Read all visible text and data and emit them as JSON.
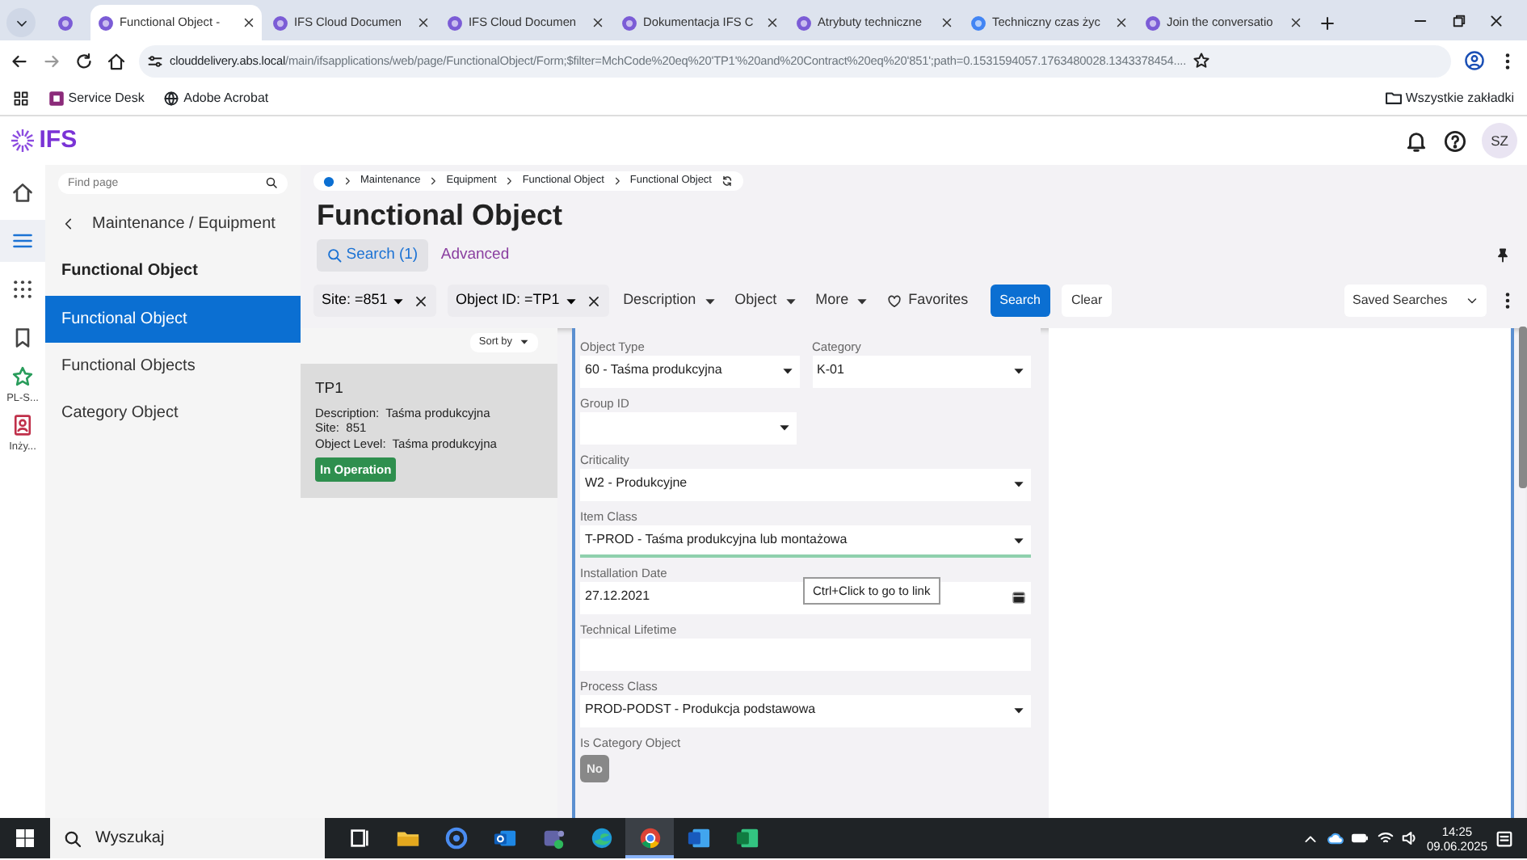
{
  "browser": {
    "tabs": [
      {
        "selected": false
      },
      {
        "title": "Functional Object -",
        "selected": true
      },
      {
        "title": "IFS Cloud Documen",
        "selected": false
      },
      {
        "title": "IFS Cloud Documen",
        "selected": false
      },
      {
        "title": "Dokumentacja IFS C",
        "selected": false
      },
      {
        "title": "Atrybuty techniczne",
        "selected": false
      },
      {
        "title": "Techniczny czas życ",
        "selected": false
      },
      {
        "title": "Join the conversatio",
        "selected": false
      }
    ],
    "url_host": "clouddelivery.abs.local",
    "url_path": "/main/ifsapplications/web/page/FunctionalObject/Form;$filter=MchCode%20eq%20'TP1'%20and%20Contract%20eq%20'851';path=0.1531594057.1763480028.1343378454....",
    "bookmarks": [
      "Service Desk",
      "Adobe Acrobat"
    ],
    "all_bookmarks": "Wszystkie zakładki"
  },
  "app": {
    "logo": "IFS",
    "avatar": "SZ",
    "rail": [
      {
        "kind": "home",
        "selected": false
      },
      {
        "kind": "menu",
        "selected": true
      },
      {
        "kind": "apps",
        "selected": false
      },
      {
        "kind": "bookmark",
        "selected": false
      },
      {
        "kind": "star",
        "label": "PL-S...",
        "selected": false
      },
      {
        "kind": "contact",
        "label": "Inży...",
        "selected": false
      }
    ]
  },
  "nav": {
    "placeholder": "Find page",
    "back_label": "Maintenance / Equipment",
    "heading": "Functional Object",
    "items": [
      {
        "label": "Functional Object",
        "selected": true
      },
      {
        "label": "Functional Objects",
        "selected": false
      },
      {
        "label": "Category Object",
        "selected": false
      }
    ]
  },
  "page": {
    "breadcrumb": [
      "Maintenance",
      "Equipment",
      "Functional Object",
      "Functional Object"
    ],
    "title": "Functional Object",
    "search_tabs": [
      {
        "label": "Search (1)",
        "selected": true
      },
      {
        "label": "Advanced",
        "selected": false
      }
    ],
    "filters": [
      {
        "kind": "chip",
        "label": "Site: =851"
      },
      {
        "kind": "chip",
        "label": "Object ID: =TP1"
      },
      {
        "kind": "menu",
        "label": "Description"
      },
      {
        "kind": "menu",
        "label": "Object"
      },
      {
        "kind": "menu",
        "label": "More"
      }
    ],
    "favorites": "Favorites",
    "search_button": "Search",
    "clear_button": "Clear",
    "saved_searches": "Saved Searches"
  },
  "list": {
    "sort_label": "Sort by",
    "records": [
      {
        "id": "TP1",
        "selected": true,
        "fields": [
          {
            "label": "Description:",
            "value": "Taśma produkcyjna"
          },
          {
            "label": "Site:",
            "value": "851"
          },
          {
            "label": "Object Level:",
            "value": "Taśma produkcyjna"
          }
        ],
        "status": "In Operation"
      }
    ]
  },
  "form": {
    "rows": [
      [
        {
          "label": "Object Type",
          "kind": "select",
          "value": "60 - Taśma produkcyjna",
          "focused": false
        },
        {
          "label": "Category",
          "kind": "select",
          "value": "K-01",
          "focused": false
        }
      ],
      [
        {
          "label": "Group ID",
          "kind": "select",
          "focused": false
        }
      ],
      [
        {
          "label": "Criticality",
          "kind": "select",
          "value": "W2 - Produkcyjne",
          "focused": false
        }
      ],
      [
        {
          "label": "Item Class",
          "kind": "select",
          "value": "T-PROD - Taśma produkcyjna lub montażowa",
          "focused": true
        }
      ],
      [
        {
          "label": "Installation Date",
          "kind": "date",
          "value": "27.12.2021",
          "focused": false
        }
      ],
      [
        {
          "label": "Technical Lifetime",
          "kind": "text",
          "focused": false
        }
      ],
      [
        {
          "label": "Process Class",
          "kind": "select",
          "value": "PROD-PODST - Produkcja podstawowa",
          "focused": false
        }
      ],
      [
        {
          "label": "Is Category Object",
          "kind": "toggle",
          "value": "No"
        }
      ]
    ],
    "tooltip": "Ctrl+Click to go to link"
  },
  "taskbar": {
    "search": "Wyszukaj",
    "apps": [
      {
        "kind": "taskview",
        "selected": false
      },
      {
        "kind": "folder",
        "selected": false
      },
      {
        "kind": "swirl",
        "selected": false
      },
      {
        "kind": "mail",
        "selected": false
      },
      {
        "kind": "teams",
        "selected": false
      },
      {
        "kind": "edge",
        "selected": false
      },
      {
        "kind": "chrome",
        "selected": true
      },
      {
        "kind": "word",
        "selected": false
      },
      {
        "kind": "excel",
        "selected": false
      }
    ],
    "time": "14:25",
    "date": "09.06.2025"
  }
}
